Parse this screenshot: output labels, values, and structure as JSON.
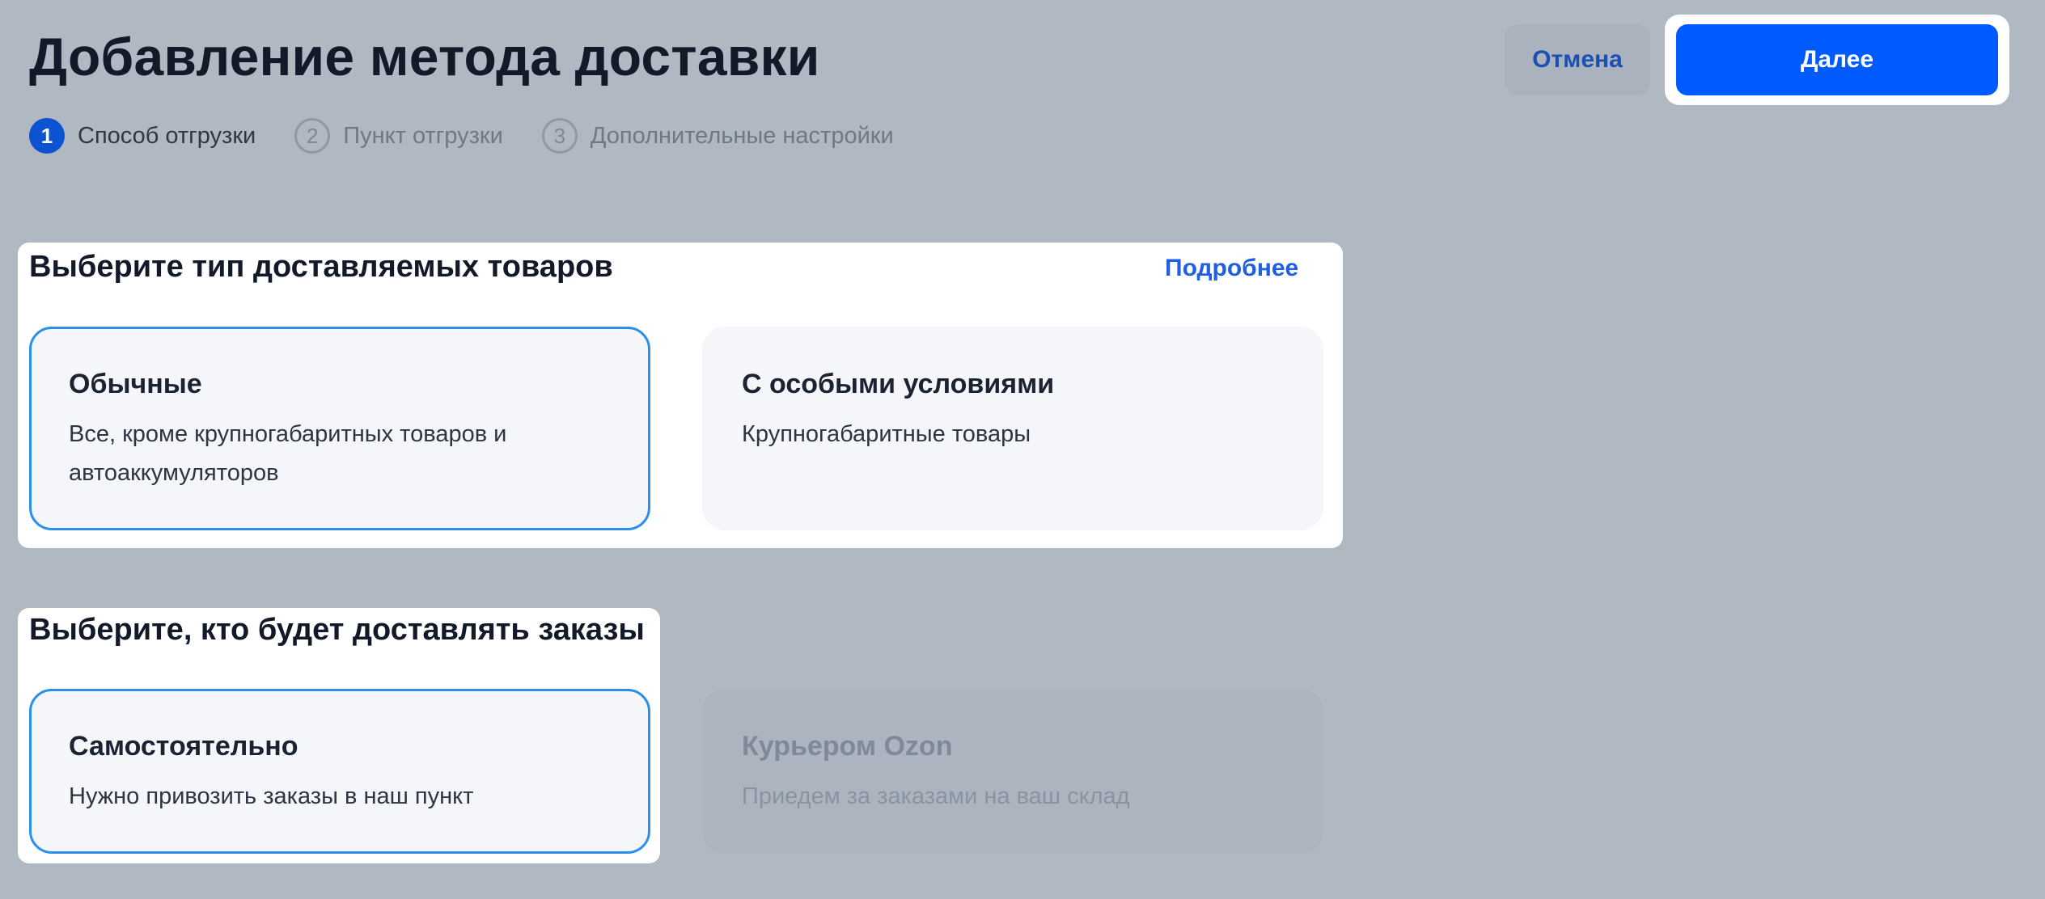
{
  "header": {
    "title": "Добавление метода доставки",
    "cancel_label": "Отмена",
    "next_label": "Далее"
  },
  "steps": [
    {
      "number": "1",
      "label": "Способ отгрузки",
      "state": "active"
    },
    {
      "number": "2",
      "label": "Пункт отгрузки",
      "state": "inactive"
    },
    {
      "number": "3",
      "label": "Дополнительные настройки",
      "state": "inactive"
    }
  ],
  "product_type": {
    "title": "Выберите тип доставляемых товаров",
    "more_link": "Подробнее",
    "options": [
      {
        "title": "Обычные",
        "description": "Все, кроме крупногабаритных товаров и автоаккумуляторов",
        "selected": true,
        "disabled": false
      },
      {
        "title": "С особыми условиями",
        "description": "Крупногабаритные товары",
        "selected": false,
        "disabled": false
      }
    ]
  },
  "delivery_by": {
    "title": "Выберите, кто будет доставлять заказы",
    "options": [
      {
        "title": "Самостоятельно",
        "description": "Нужно привозить заказы в наш пункт",
        "selected": true,
        "disabled": false
      },
      {
        "title": "Курьером Ozon",
        "description": "Приедем за заказами на ваш склад",
        "selected": false,
        "disabled": true
      }
    ]
  },
  "colors": {
    "primary": "#005bff",
    "selected_border": "#2a8ff0",
    "link": "#1f5fe3",
    "overlay_background": "#b0b8c1"
  }
}
